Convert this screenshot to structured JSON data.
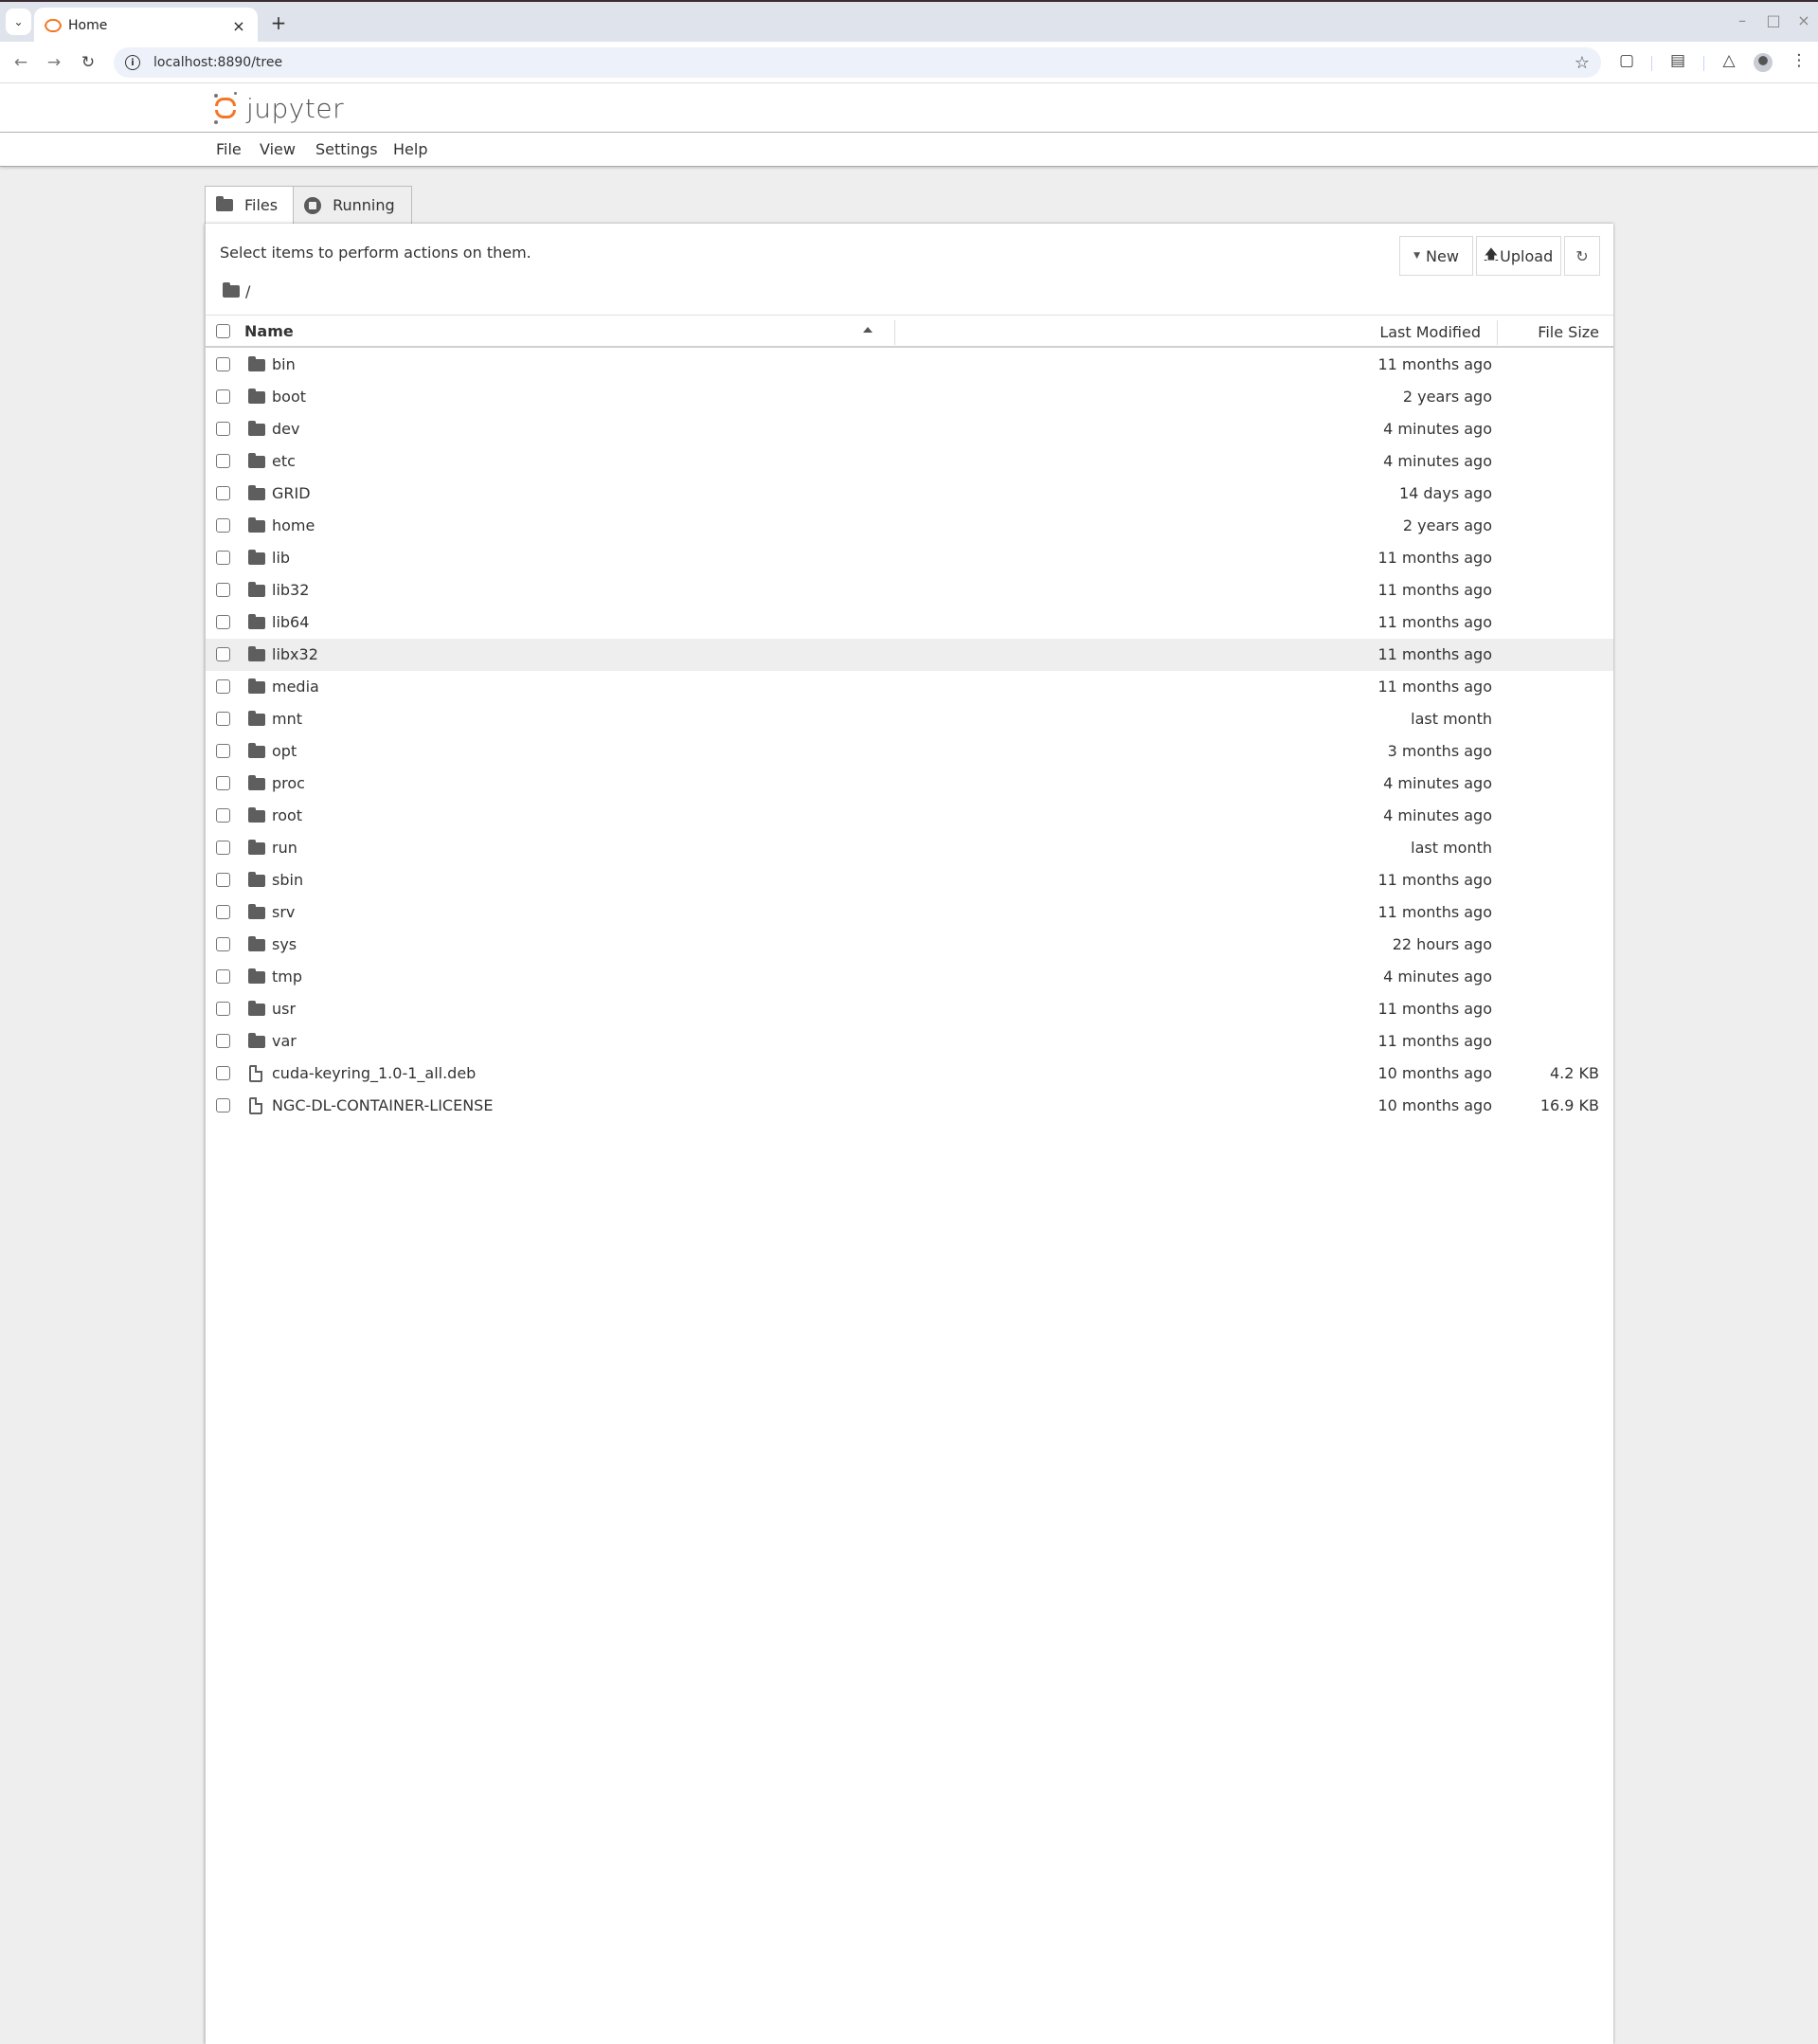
{
  "browser": {
    "tab_title": "Home",
    "url": "localhost:8890/tree",
    "icons": {
      "tab_list": "chevron-down-icon",
      "tab_close": "close-icon",
      "new_tab": "plus-icon",
      "back": "arrow-left-icon",
      "forward": "arrow-right-icon",
      "reload": "reload-icon",
      "site_info": "info-icon",
      "bookmark": "star-icon",
      "extensions": "puzzle-icon",
      "reading_list": "list-icon",
      "labs": "flask-icon",
      "profile": "avatar",
      "menu": "kebab-menu-icon"
    }
  },
  "app": {
    "logo_text": "jupyter",
    "brand_color": "#f37726",
    "menu": [
      "File",
      "View",
      "Settings",
      "Help"
    ]
  },
  "panel": {
    "tabs": [
      {
        "label": "Files",
        "icon": "folder-icon",
        "active": true
      },
      {
        "label": "Running",
        "icon": "running-icon",
        "active": false
      }
    ],
    "toolbar_hint": "Select items to perform actions on them.",
    "buttons": {
      "new": "New",
      "upload": "Upload",
      "refresh": "refresh-icon"
    },
    "breadcrumb": "/",
    "columns": {
      "name": "Name",
      "last_modified": "Last Modified",
      "file_size": "File Size",
      "sort": "ascending"
    },
    "items": [
      {
        "name": "bin",
        "type": "folder",
        "modified": "11 months ago",
        "size": ""
      },
      {
        "name": "boot",
        "type": "folder",
        "modified": "2 years ago",
        "size": ""
      },
      {
        "name": "dev",
        "type": "folder",
        "modified": "4 minutes ago",
        "size": ""
      },
      {
        "name": "etc",
        "type": "folder",
        "modified": "4 minutes ago",
        "size": ""
      },
      {
        "name": "GRID",
        "type": "folder",
        "modified": "14 days ago",
        "size": ""
      },
      {
        "name": "home",
        "type": "folder",
        "modified": "2 years ago",
        "size": ""
      },
      {
        "name": "lib",
        "type": "folder",
        "modified": "11 months ago",
        "size": ""
      },
      {
        "name": "lib32",
        "type": "folder",
        "modified": "11 months ago",
        "size": ""
      },
      {
        "name": "lib64",
        "type": "folder",
        "modified": "11 months ago",
        "size": ""
      },
      {
        "name": "libx32",
        "type": "folder",
        "modified": "11 months ago",
        "size": "",
        "hovered": true
      },
      {
        "name": "media",
        "type": "folder",
        "modified": "11 months ago",
        "size": ""
      },
      {
        "name": "mnt",
        "type": "folder",
        "modified": "last month",
        "size": ""
      },
      {
        "name": "opt",
        "type": "folder",
        "modified": "3 months ago",
        "size": ""
      },
      {
        "name": "proc",
        "type": "folder",
        "modified": "4 minutes ago",
        "size": ""
      },
      {
        "name": "root",
        "type": "folder",
        "modified": "4 minutes ago",
        "size": ""
      },
      {
        "name": "run",
        "type": "folder",
        "modified": "last month",
        "size": ""
      },
      {
        "name": "sbin",
        "type": "folder",
        "modified": "11 months ago",
        "size": ""
      },
      {
        "name": "srv",
        "type": "folder",
        "modified": "11 months ago",
        "size": ""
      },
      {
        "name": "sys",
        "type": "folder",
        "modified": "22 hours ago",
        "size": ""
      },
      {
        "name": "tmp",
        "type": "folder",
        "modified": "4 minutes ago",
        "size": ""
      },
      {
        "name": "usr",
        "type": "folder",
        "modified": "11 months ago",
        "size": ""
      },
      {
        "name": "var",
        "type": "folder",
        "modified": "11 months ago",
        "size": ""
      },
      {
        "name": "cuda-keyring_1.0-1_all.deb",
        "type": "file",
        "modified": "10 months ago",
        "size": "4.2 KB"
      },
      {
        "name": "NGC-DL-CONTAINER-LICENSE",
        "type": "file",
        "modified": "10 months ago",
        "size": "16.9 KB"
      }
    ]
  }
}
